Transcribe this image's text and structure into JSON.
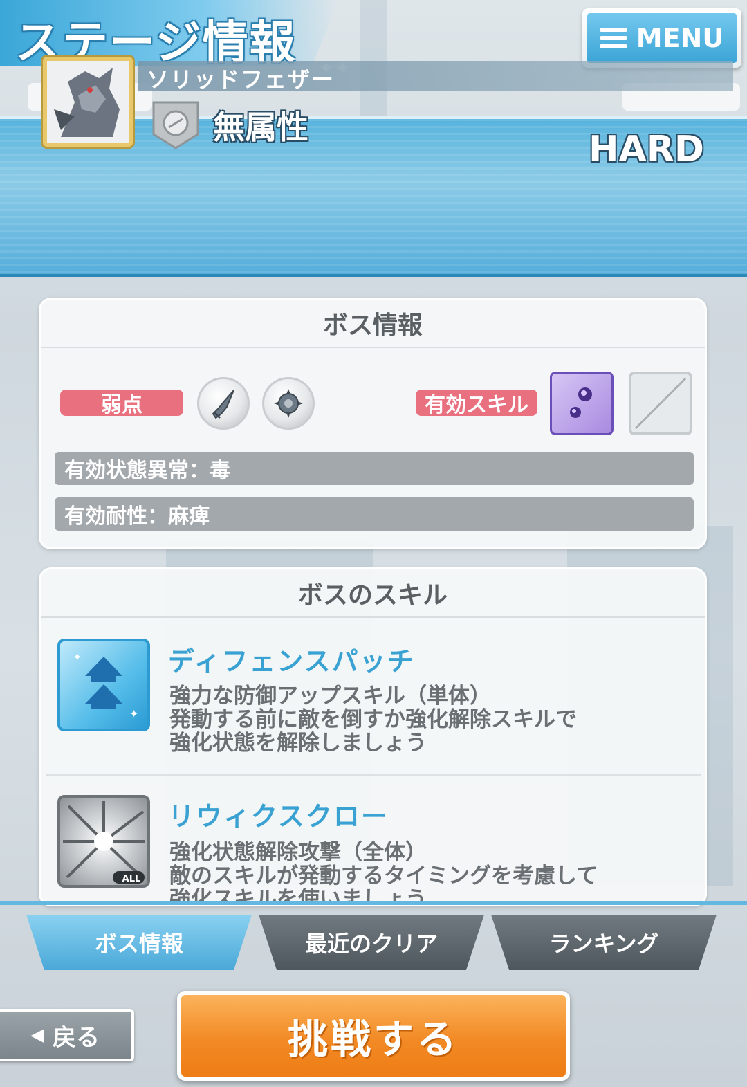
{
  "header": {
    "title": "ステージ情報",
    "menu_label": "MENU"
  },
  "stage": {
    "difficulty": "HARD",
    "boss_name": "ソリッドフェザー",
    "attribute": "無属性"
  },
  "boss_info": {
    "title": "ボス情報",
    "weakness_label": "弱点",
    "effective_skill_label": "有効スキル",
    "status_ailment": "有効状態異常：毒",
    "resistance": "有効耐性：麻痺"
  },
  "boss_skills": {
    "title": "ボスのスキル",
    "items": [
      {
        "name": "ディフェンスパッチ",
        "desc_line1": "強力な防御アップスキル（単体）",
        "desc_line2": "発動する前に敵を倒すか強化解除スキルで",
        "desc_line3": "強化状態を解除しましょう"
      },
      {
        "name": "リウィクスクロー",
        "badge": "ALL",
        "desc_line1": "強化状態解除攻撃（全体）",
        "desc_line2": "敵のスキルが発動するタイミングを考慮して",
        "desc_line3": "強化スキルを使いましょう"
      }
    ]
  },
  "tabs": {
    "boss_info": "ボス情報",
    "recent_clear": "最近のクリア",
    "ranking": "ランキング"
  },
  "footer": {
    "back_label": "戻る",
    "challenge_label": "挑戦する"
  }
}
